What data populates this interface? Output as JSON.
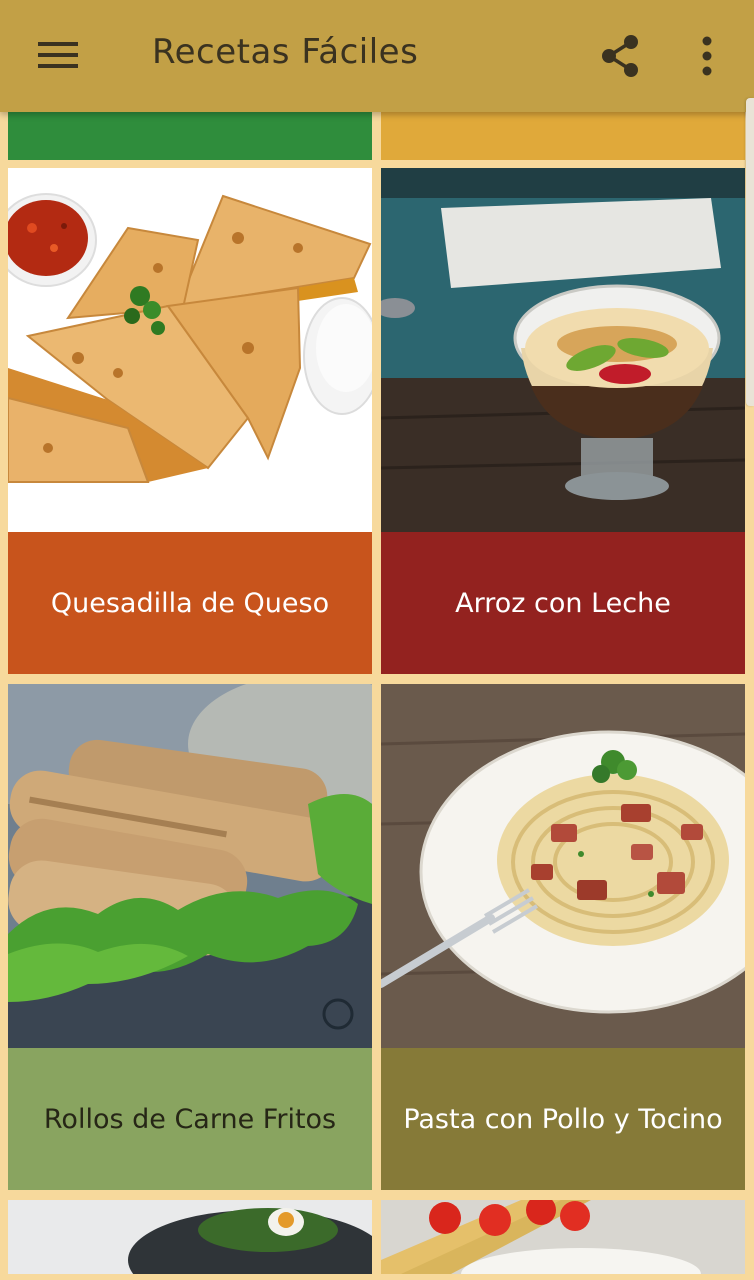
{
  "app_bar": {
    "title": "Recetas Fáciles",
    "menu_icon": "hamburger-menu-icon",
    "share_icon": "share-icon",
    "more_icon": "more-vertical-icon",
    "background": "#c2a046"
  },
  "recipes": [
    {
      "name": "Quesadilla de Queso",
      "color": "#c8541c",
      "text_color": "#ffffff"
    },
    {
      "name": "Arroz con Leche",
      "color": "#93221f",
      "text_color": "#ffffff"
    },
    {
      "name": "Rollos de Carne Fritos",
      "color": "#89a460",
      "text_color": "#262616"
    },
    {
      "name": "Pasta con Pollo y Tocino",
      "color": "#867a38",
      "text_color": "#ffffff"
    }
  ],
  "top_strips": [
    {
      "color": "#2f8d3c"
    },
    {
      "color": "#e0a93a"
    }
  ]
}
